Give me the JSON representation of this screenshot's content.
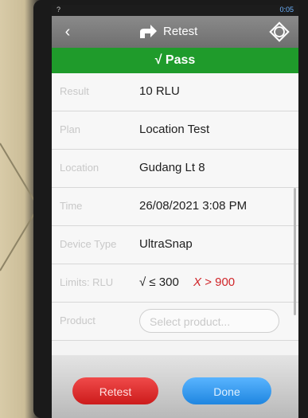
{
  "status": {
    "left": "?",
    "right": "0:05"
  },
  "header": {
    "title": "Retest",
    "back_icon": "chevron-left-icon",
    "action_icon": "retest-arrow-icon",
    "sync_icon": "sync-icon"
  },
  "result_banner": {
    "text": "√ Pass",
    "color": "#1f9b2b"
  },
  "fields": [
    {
      "label": "Result",
      "value": "10 RLU"
    },
    {
      "label": "Plan",
      "value": "Location Test"
    },
    {
      "label": "Location",
      "value": "Gudang Lt 8"
    },
    {
      "label": "Time",
      "value": "26/08/2021 3:08 PM"
    },
    {
      "label": "Device Type",
      "value": "UltraSnap"
    }
  ],
  "limits": {
    "label": "Limits: RLU",
    "pass": "√ ≤ 300",
    "fail_mark": "X",
    "fail": "> 900"
  },
  "product": {
    "label": "Product",
    "placeholder": "Select product..."
  },
  "buttons": {
    "retest": "Retest",
    "done": "Done"
  }
}
